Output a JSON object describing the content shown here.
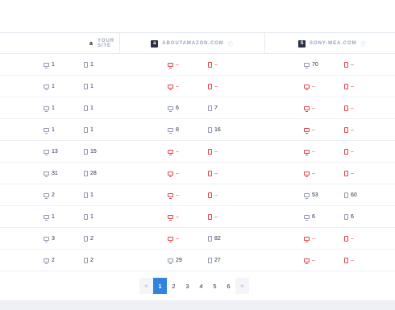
{
  "columns": {
    "your_site": {
      "label": "YOUR SITE",
      "icon": "a"
    },
    "aboutamazon": {
      "label": "ABOUTAMAZON.COM",
      "icon": "a",
      "info": "ⓘ"
    },
    "sony": {
      "label": "SONY-MEA.COM",
      "icon": "S",
      "info": "ⓘ"
    }
  },
  "rows": [
    {
      "ys_desktop": "1",
      "ys_mobile": "1",
      "am_desktop": "–",
      "am_mobile": "–",
      "sn_desktop": "70",
      "sn_mobile": "–"
    },
    {
      "ys_desktop": "1",
      "ys_mobile": "1",
      "am_desktop": "–",
      "am_mobile": "–",
      "sn_desktop": "–",
      "sn_mobile": "–"
    },
    {
      "ys_desktop": "1",
      "ys_mobile": "1",
      "am_desktop": "6",
      "am_mobile": "7",
      "sn_desktop": "–",
      "sn_mobile": "–"
    },
    {
      "ys_desktop": "1",
      "ys_mobile": "1",
      "am_desktop": "8",
      "am_mobile": "16",
      "sn_desktop": "–",
      "sn_mobile": "–"
    },
    {
      "ys_desktop": "13",
      "ys_mobile": "15",
      "am_desktop": "–",
      "am_mobile": "–",
      "sn_desktop": "–",
      "sn_mobile": "–"
    },
    {
      "ys_desktop": "31",
      "ys_mobile": "28",
      "am_desktop": "–",
      "am_mobile": "–",
      "sn_desktop": "–",
      "sn_mobile": "–"
    },
    {
      "ys_desktop": "2",
      "ys_mobile": "1",
      "am_desktop": "–",
      "am_mobile": "–",
      "sn_desktop": "53",
      "sn_mobile": "60"
    },
    {
      "ys_desktop": "1",
      "ys_mobile": "1",
      "am_desktop": "–",
      "am_mobile": "–",
      "sn_desktop": "6",
      "sn_mobile": "6"
    },
    {
      "ys_desktop": "3",
      "ys_mobile": "2",
      "am_desktop": "–",
      "am_mobile": "82",
      "sn_desktop": "–",
      "sn_mobile": "–"
    },
    {
      "ys_desktop": "2",
      "ys_mobile": "2",
      "am_desktop": "29",
      "am_mobile": "27",
      "sn_desktop": "–",
      "sn_mobile": "–"
    }
  ],
  "pagination": {
    "prev": "«",
    "pages": [
      "1",
      "2",
      "3",
      "4",
      "5",
      "6"
    ],
    "next": "»",
    "active": "1"
  },
  "colors": {
    "accent": "#2f84e0",
    "missing": "#e2434b"
  }
}
